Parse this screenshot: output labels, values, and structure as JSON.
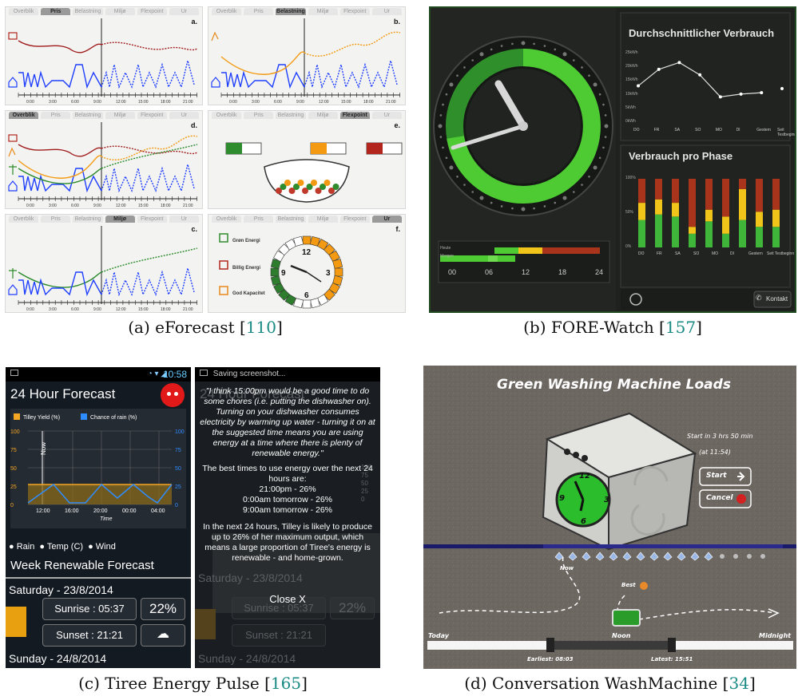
{
  "captions": {
    "a": {
      "prefix": "(a) eForecast [",
      "ref": "110",
      "suffix": "]"
    },
    "b": {
      "prefix": "(b) FORE-Watch [",
      "ref": "157",
      "suffix": "]"
    },
    "c": {
      "prefix": "(c) Tiree Energy Pulse [",
      "ref": "165",
      "suffix": "]"
    },
    "d": {
      "prefix": "(d) Conversation WashMachine [",
      "ref": "34",
      "suffix": "]"
    }
  },
  "eforecast": {
    "tabs": [
      "Overblik",
      "Pris",
      "Belastning",
      "Miljø",
      "Flexpoint",
      "Ur"
    ],
    "panels": [
      {
        "letter": "a.",
        "active": 1
      },
      {
        "letter": "b.",
        "active": 2
      },
      {
        "letter": "d.",
        "active": 0
      },
      {
        "letter": "e.",
        "active": 4
      },
      {
        "letter": "c.",
        "active": 3
      },
      {
        "letter": "f.",
        "active": 5
      }
    ],
    "times": [
      "0:00",
      "3:00",
      "6:00",
      "9:00",
      "12:00",
      "15:00",
      "18:00",
      "21:00"
    ],
    "clock_labels": {
      "twelve": "12",
      "three": "3",
      "six": "6",
      "nine": "9"
    },
    "legend": {
      "green": "Grøn Energi",
      "red": "Billig Energi",
      "orange": "God Kapacitet"
    }
  },
  "forewatch": {
    "avg_title": "Durchschnittlicher Verbrauch",
    "phase_title": "Verbrauch pro Phase",
    "y_avg": [
      "25kWh",
      "20kWh",
      "15kWh",
      "10kWh",
      "5kWh",
      "0kWh"
    ],
    "y_phase": [
      "100%",
      "50%",
      "0%"
    ],
    "days": [
      "DO",
      "FR",
      "SA",
      "SO",
      "MO",
      "DI",
      "Gestern",
      "Seit Testbeginn"
    ],
    "avg_values": [
      13.5,
      19.5,
      22,
      17.5,
      9.5,
      10.5,
      11,
      12.5
    ],
    "phase_values": [
      {
        "green": 40,
        "yellow": 25,
        "red": 35
      },
      {
        "green": 48,
        "yellow": 22,
        "red": 30
      },
      {
        "green": 45,
        "yellow": 20,
        "red": 35
      },
      {
        "green": 20,
        "yellow": 10,
        "red": 70
      },
      {
        "green": 38,
        "yellow": 17,
        "red": 45
      },
      {
        "green": 20,
        "yellow": 25,
        "red": 55
      },
      {
        "green": 40,
        "yellow": 45,
        "red": 15
      },
      {
        "green": 30,
        "yellow": 22,
        "red": 48
      },
      {
        "green": 30,
        "yellow": 25,
        "red": 45
      }
    ],
    "timeline_labels": [
      "00",
      "06",
      "12",
      "18",
      "24"
    ],
    "row_today": "Heute",
    "row_tomorrow": "Morgen",
    "contact_label": "Kontakt",
    "colors": {
      "green": "#3fb53a",
      "yellow": "#f0c419",
      "red": "#a8341c"
    }
  },
  "tiree": {
    "time": "10:58",
    "title": "24 Hour Forecast",
    "legend_yield": "Tilley Yield (%)",
    "legend_rain": "Chance of rain (%)",
    "y_ticks": [
      "100",
      "75",
      "50",
      "25",
      "0"
    ],
    "x_ticks": [
      "12:00",
      "16:00",
      "20:00",
      "00:00",
      "04:00"
    ],
    "x_label": "Time",
    "now_label": "Now",
    "radio": [
      "Rain",
      "Temp (C)",
      "Wind"
    ],
    "week_title": "Week Renewable Forecast",
    "day1": "Saturday - 23/8/2014",
    "sunrise": "Sunrise : 05:37",
    "sunset": "Sunset : 21:21",
    "percent": "22%",
    "day2": "Sunday - 24/8/2014",
    "screenshot_text": "Saving screenshot...",
    "popup_quote": "\"I think 15:00pm would be a good time to do some chores (i.e. putting the dishwasher on). Turning on your dishwasher consumes electricity by warming up water - turning it on at the suggested time means you are using energy at a time where there is plenty of renewable energy.\"",
    "popup_best": "The best times to use energy over the next 24 hours are:",
    "popup_t1": "21:00pm - 26%",
    "popup_t2": "0:00am tomorrow - 26%",
    "popup_t3": "9:00am tomorrow - 26%",
    "popup_forecast": "In the next 24 hours, Tilley is likely to produce up to 26% of her maximum output, which means a large proportion of Tiree's energy is renewable - and home-grown.",
    "close": "Close X",
    "title_faded": "24 Hour Forecast",
    "y_ticks_right": [
      "100",
      "75",
      "50",
      "25",
      "0"
    ]
  },
  "washing": {
    "title": "Green Washing Machine Loads",
    "start_in": "Start in 3 hrs 50 min",
    "at": "(at 11:54)",
    "start_btn": "Start",
    "cancel_btn": "Cancel",
    "now": "Now",
    "best": "Best",
    "today": "Today",
    "noon": "Noon",
    "midnight": "Midnight",
    "earliest": "Earliest: 08:03",
    "latest": "Latest: 15:51",
    "clock": {
      "twelve": "12",
      "three": "3",
      "six": "6",
      "nine": "9"
    }
  }
}
